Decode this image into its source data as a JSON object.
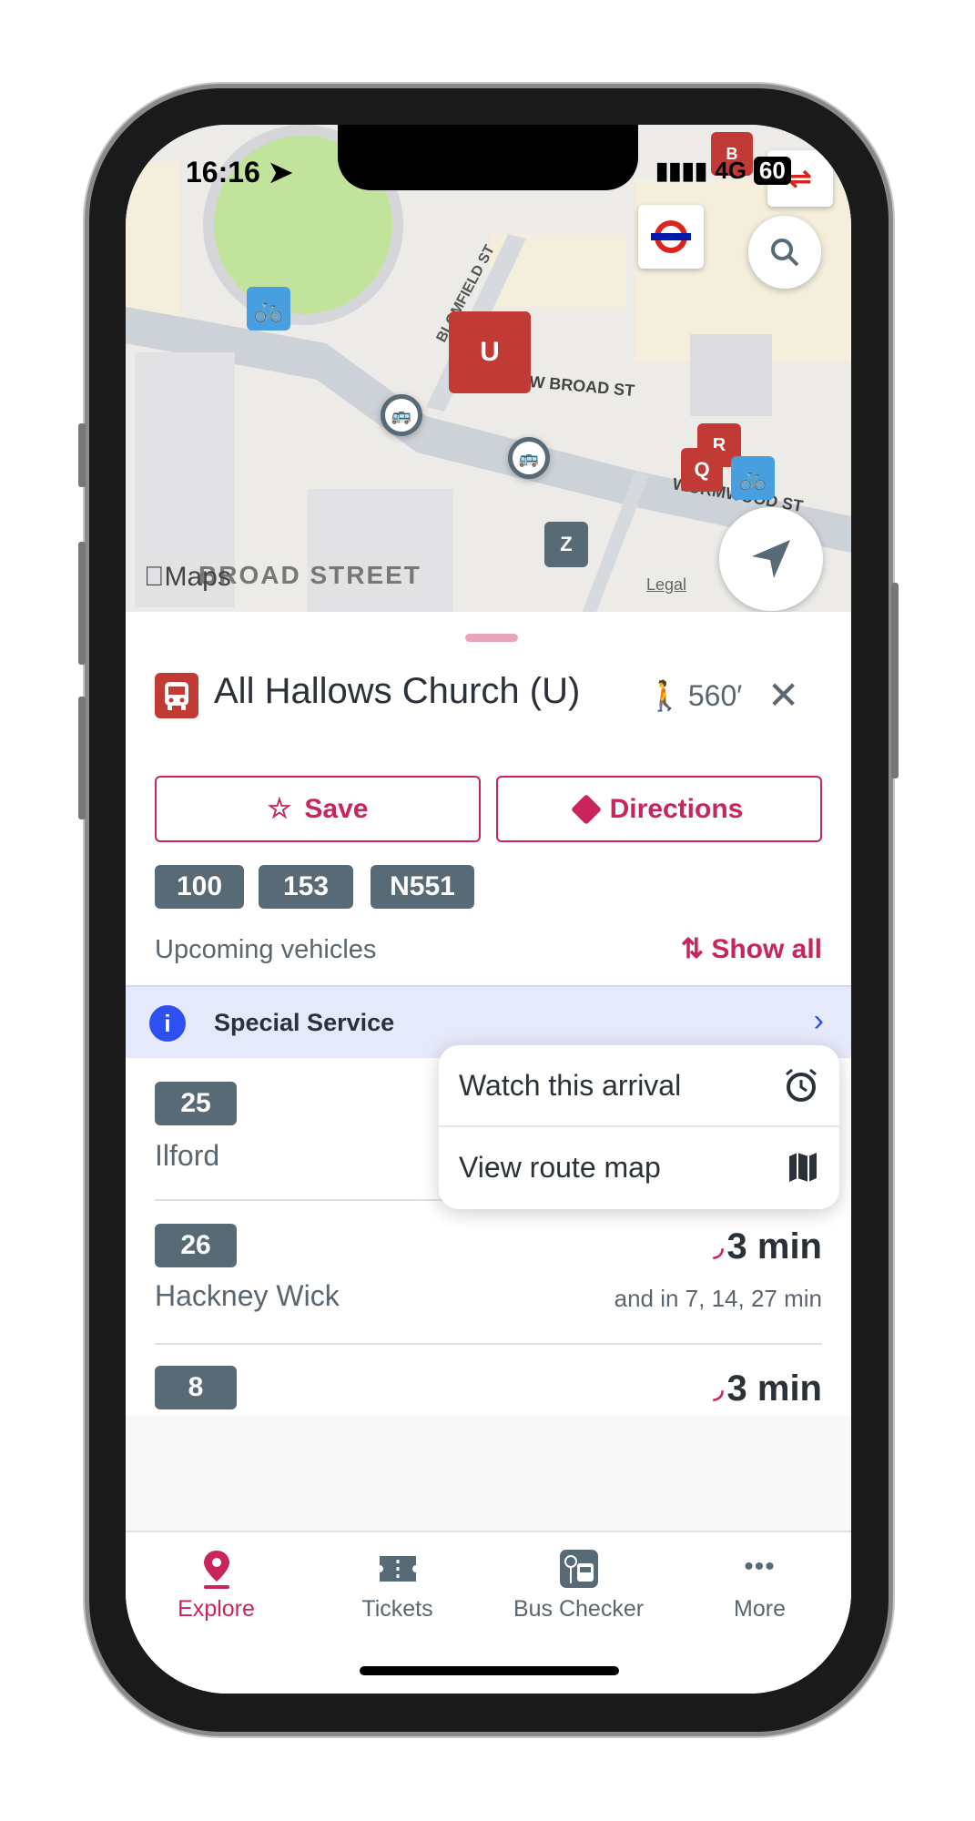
{
  "status": {
    "time": "16:16",
    "network": "4G",
    "battery": "60"
  },
  "map": {
    "street_labels": [
      "BLOMFIELD ST",
      "W BROAD ST",
      "WORMWOOD ST",
      "BROAD STREET"
    ],
    "stop_pins": [
      "U",
      "Z",
      "Q",
      "R",
      "B"
    ],
    "attribution": "Maps",
    "legal": "Legal",
    "icons": [
      "search-icon",
      "location-arrow-icon",
      "underground-roundel-icon",
      "national-rail-icon",
      "bike-dock-icon",
      "bus-stop-icon"
    ]
  },
  "stop": {
    "name": "All Hallows Church (U)",
    "walk_distance": "560′",
    "routes": [
      "100",
      "153",
      "N551"
    ]
  },
  "actions": {
    "save": "Save",
    "directions": "Directions"
  },
  "upcoming": {
    "label": "Upcoming vehicles",
    "show_all": "Show all"
  },
  "banner": {
    "text": "Special Service"
  },
  "arrivals": [
    {
      "route": "25",
      "destination": "Ilford",
      "eta": "",
      "more": ""
    },
    {
      "route": "26",
      "destination": "Hackney Wick",
      "eta": "3 min",
      "more": "and in 7, 14, 27 min"
    },
    {
      "route": "8",
      "destination": "",
      "eta": "3 min",
      "more": ""
    }
  ],
  "menu": {
    "watch": "Watch this arrival",
    "route_map": "View route map"
  },
  "tabs": [
    {
      "label": "Explore",
      "active": true
    },
    {
      "label": "Tickets"
    },
    {
      "label": "Bus Checker"
    },
    {
      "label": "More"
    }
  ],
  "colors": {
    "accent": "#c9255a",
    "bus_red": "#c23a35",
    "chip": "#586a76",
    "banner": "#e5e9fa",
    "info": "#2f50f0"
  }
}
